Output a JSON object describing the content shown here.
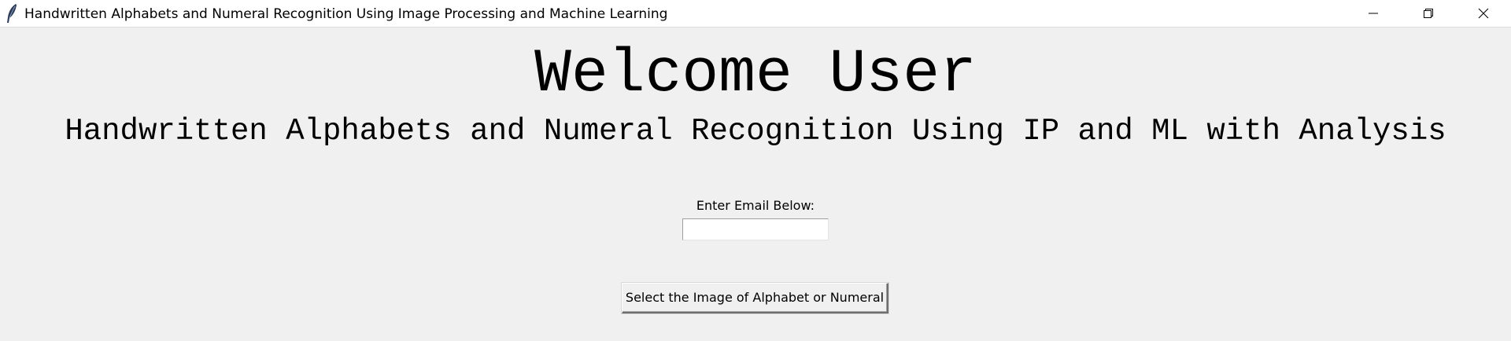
{
  "window": {
    "title": "Handwritten Alphabets and Numeral Recognition Using Image Processing and Machine Learning",
    "icon": "feather-icon",
    "controls": {
      "minimize_icon": "minimize-icon",
      "maximize_icon": "restore-icon",
      "close_icon": "close-icon"
    }
  },
  "main": {
    "welcome": "Welcome User",
    "subtitle": "Handwritten Alphabets and Numeral Recognition Using IP and ML with Analysis",
    "email": {
      "label": "Enter Email Below:",
      "value": "",
      "placeholder": ""
    },
    "select_button": "Select the Image of Alphabet or Numeral"
  },
  "colors": {
    "background": "#f0f0f0",
    "titlebar": "#ffffff",
    "text": "#000000"
  }
}
